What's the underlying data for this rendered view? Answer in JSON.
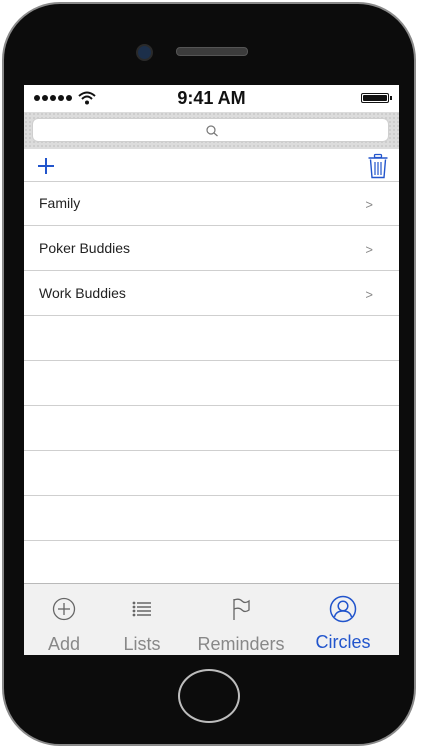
{
  "status_bar": {
    "time": "9:41 AM"
  },
  "toolbar": {
    "add_icon": "plus-icon",
    "delete_icon": "trash-icon"
  },
  "list": {
    "items": [
      {
        "label": "Family",
        "chevron": ">"
      },
      {
        "label": "Poker Buddies",
        "chevron": ">"
      },
      {
        "label": "Work Buddies",
        "chevron": ">"
      }
    ]
  },
  "tabbar": {
    "tabs": [
      {
        "label": "Add",
        "icon": "add-circle-icon"
      },
      {
        "label": "Lists",
        "icon": "list-icon"
      },
      {
        "label": "Reminders",
        "icon": "flag-icon"
      },
      {
        "label": "Circles",
        "icon": "person-circle-icon",
        "active": true
      }
    ]
  },
  "colors": {
    "accent": "#2255cc",
    "tab_inactive": "#888888",
    "divider": "#cfcfcf"
  }
}
